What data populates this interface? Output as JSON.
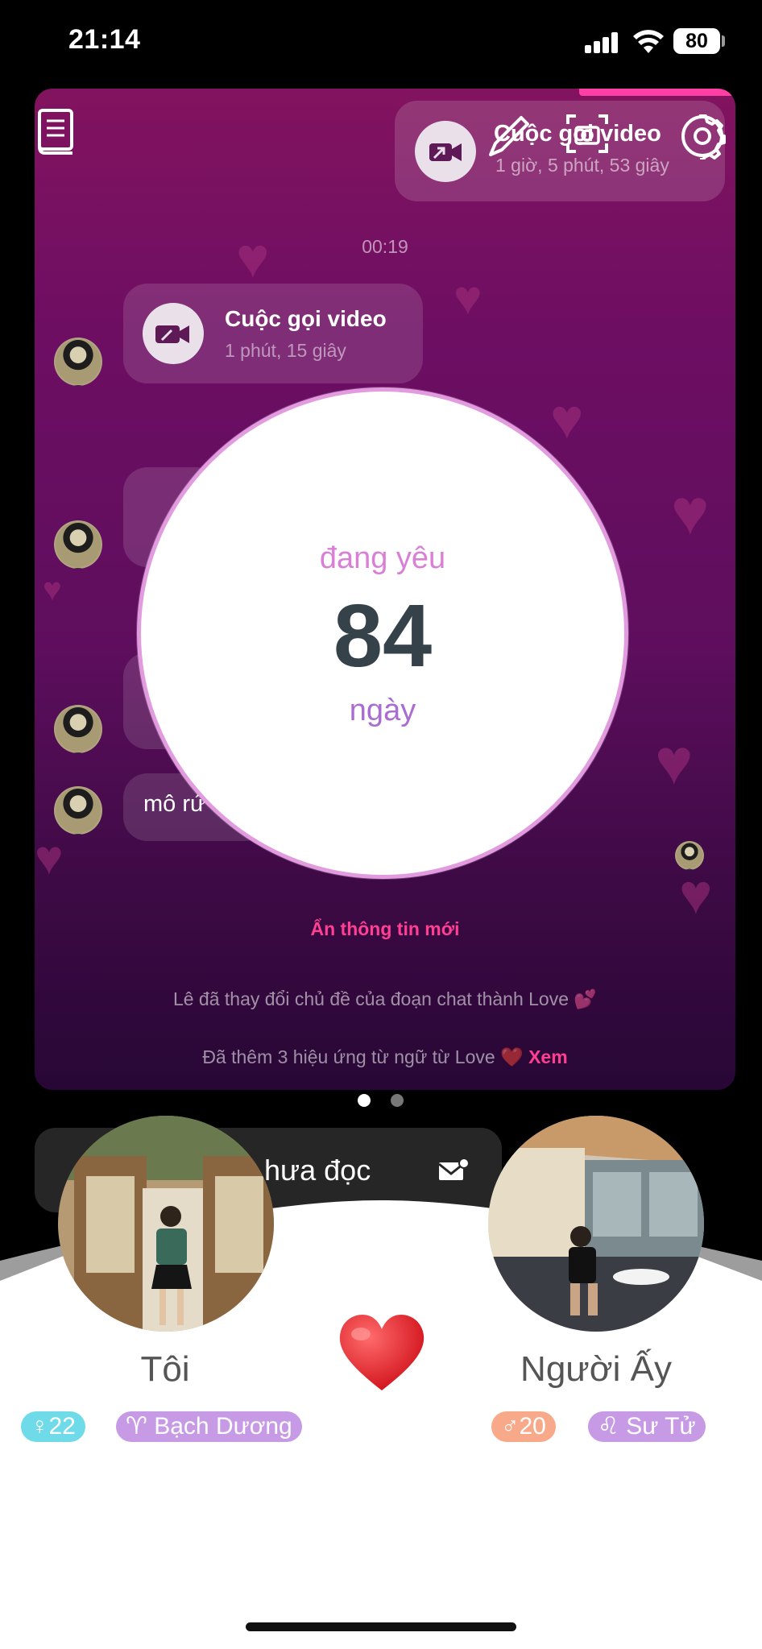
{
  "status_bar": {
    "time": "21:14",
    "battery": "80"
  },
  "header": {
    "pinned_call": {
      "title": "Cuộc gọi video",
      "duration": "1 giờ, 5 phút, 53 giây"
    }
  },
  "chat": {
    "timestamp": "00:19",
    "call_message": {
      "title": "Cuộc gọi video",
      "duration": "1 phút, 15 giây"
    },
    "text_message_partial": "mô rứ",
    "hide_new_info": "Ẩn thông tin mới",
    "theme_notice": "Lê đã thay đổi chủ đề của đoạn chat thành Love 💕",
    "effects_notice": "Đã thêm 3 hiệu ứng từ ngữ từ Love ❤️",
    "effects_link": "Xem"
  },
  "love_counter": {
    "label": "đang yêu",
    "days": "84",
    "unit": "ngày"
  },
  "unread": {
    "label": "hưa đọc"
  },
  "profiles": {
    "me": {
      "name": "Tôi",
      "age_tag": "♀22",
      "zodiac_tag": "♈ Bạch Dương"
    },
    "partner": {
      "name": "Người Ấy",
      "age_tag": "♂20",
      "zodiac_tag": "♌ Sư Tử"
    }
  },
  "colors": {
    "accent_pink": "#ff3f92",
    "female_tag": "#6fdbe8",
    "zodiac_tag": "#c79ae6",
    "male_tag": "#f7a98a",
    "counter_ring": "#e39be0"
  },
  "icons": [
    "book-icon",
    "edit-icon",
    "camera-icon",
    "gear-icon",
    "video-call-icon",
    "mail-icon",
    "heart-icon"
  ],
  "pagination": {
    "total": 2,
    "active": 1
  }
}
